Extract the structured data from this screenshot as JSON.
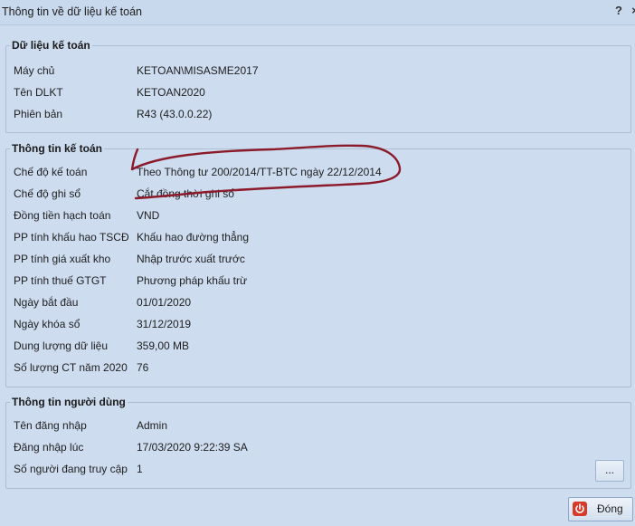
{
  "window": {
    "title": "Thông tin về dữ liệu kế toán"
  },
  "titlebar": {
    "help_glyph": "?",
    "close_glyph": "×"
  },
  "data_group": {
    "title": "Dữ liệu kế toán",
    "rows": [
      {
        "label": "Máy chủ",
        "value": "KETOAN\\MISASME2017"
      },
      {
        "label": "Tên DLKT",
        "value": "KETOAN2020"
      },
      {
        "label": "Phiên bản",
        "value": "R43 (43.0.0.22)"
      }
    ]
  },
  "accounting_group": {
    "title": "Thông tin kế toán",
    "rows": [
      {
        "label": "Chế độ kế toán",
        "value": "Theo Thông tư 200/2014/TT-BTC ngày 22/12/2014"
      },
      {
        "label": "Chế độ ghi sổ",
        "value": "Cắt đồng thời ghi sổ"
      },
      {
        "label": "Đồng tiền hạch toán",
        "value": "VND"
      },
      {
        "label": "PP tính khấu hao TSCĐ",
        "value": "Khấu hao đường thẳng"
      },
      {
        "label": "PP tính giá xuất kho",
        "value": "Nhập trước xuất trước"
      },
      {
        "label": "PP tính thuế GTGT",
        "value": "Phương pháp khấu trừ"
      },
      {
        "label": "Ngày bắt đầu",
        "value": "01/01/2020"
      },
      {
        "label": "Ngày khóa sổ",
        "value": "31/12/2019"
      },
      {
        "label": "Dung lượng dữ liệu",
        "value": "359,00 MB"
      },
      {
        "label": "Số lượng CT năm 2020",
        "value": "76"
      }
    ]
  },
  "user_group": {
    "title": "Thông tin người dùng",
    "rows": [
      {
        "label": "Tên đăng nhập",
        "value": "Admin"
      },
      {
        "label": "Đăng nhập lúc",
        "value": "17/03/2020 9:22:39 SA"
      },
      {
        "label": "Số người đang truy cập",
        "value": "1"
      }
    ],
    "details_button_label": "..."
  },
  "footer": {
    "close_button_label": "Đóng"
  },
  "colors": {
    "annotation": "#8b1a2b",
    "close_icon": "#d53a2b"
  }
}
